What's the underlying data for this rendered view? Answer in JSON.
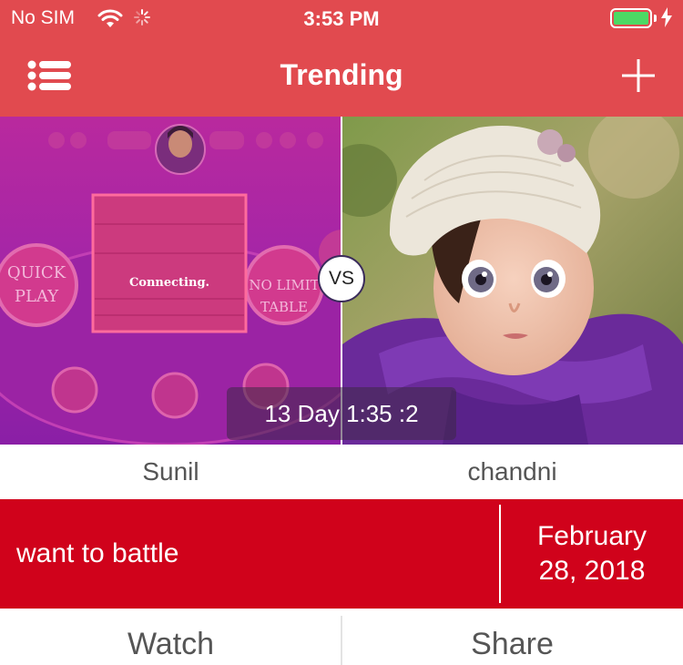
{
  "status_bar": {
    "carrier": "No SIM",
    "time": "3:53 PM",
    "battery_color": "#4cd964"
  },
  "nav": {
    "title": "Trending",
    "menu_icon": "list-icon",
    "add_icon": "plus-icon",
    "bar_color": "#e14a4f"
  },
  "battle": {
    "vs_label": "VS",
    "timer": "13 Day 1:35 :2",
    "left": {
      "name": "Sunil",
      "image": "game lobby screenshot with Connecting. dialog",
      "screenshot_text": {
        "quick_play": [
          "QUICK",
          "PLAY"
        ],
        "dialog": "Connecting.",
        "no_limit": [
          "NO LIMIT",
          "TABLE"
        ]
      }
    },
    "right": {
      "name": "chandni",
      "image": "photo of a toddler in a knit cap and purple sweater"
    }
  },
  "info": {
    "message": "want to battle",
    "date_month_day": "February",
    "date_day_year": "28, 2018",
    "color": "#d0021b"
  },
  "actions": {
    "watch_label": "Watch",
    "share_label": "Share"
  }
}
